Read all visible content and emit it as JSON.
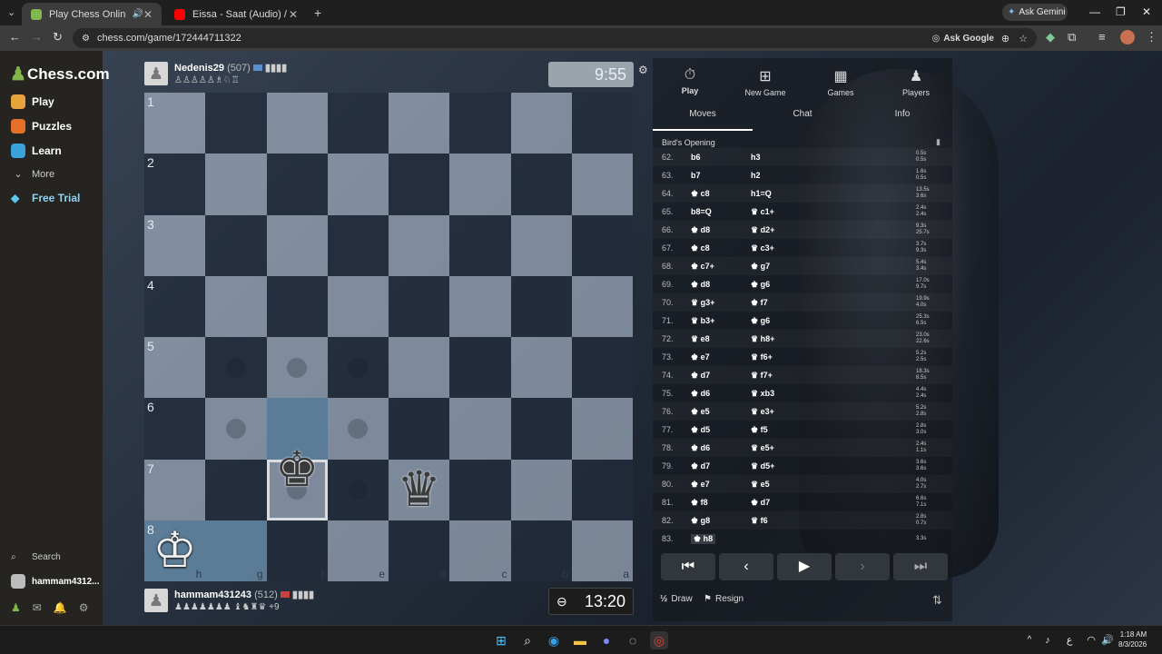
{
  "browser": {
    "tabs": [
      {
        "title": "Play Chess Online for FREE",
        "active": true
      },
      {
        "title": "Eissa - Saat (Audio) / ساعات - ...",
        "active": false
      }
    ],
    "url": "chess.com/game/172444711322",
    "ask_gemini": "Ask Gemini",
    "ask_google": "Ask Google"
  },
  "sidebar": {
    "logo": "Chess.com",
    "items": [
      {
        "label": "Play",
        "color": "#e8a33d"
      },
      {
        "label": "Puzzles",
        "color": "#e5702a"
      },
      {
        "label": "Learn",
        "color": "#3aa2d8"
      },
      {
        "label": "More",
        "color": "#888888"
      },
      {
        "label": "Free Trial",
        "color": "#5ec9e8"
      }
    ],
    "search": "Search",
    "user": "hammam4312..."
  },
  "top_player": {
    "name": "Nedenis29",
    "rating": "(507)",
    "clock": "9:55"
  },
  "bottom_player": {
    "name": "hammam431243",
    "rating": "(512)",
    "extra": "+9",
    "clock": "13:20"
  },
  "board": {
    "ranks": [
      "1",
      "2",
      "3",
      "4",
      "5",
      "6",
      "7",
      "8"
    ],
    "files": [
      "h",
      "g",
      "f",
      "e",
      "d",
      "c",
      "b",
      "a"
    ]
  },
  "panel": {
    "tabs": [
      "Play",
      "New Game",
      "Games",
      "Players"
    ],
    "subtabs": [
      "Moves",
      "Chat",
      "Info"
    ],
    "opening": "Bird's Opening",
    "moves": [
      {
        "n": "62.",
        "w": "b6",
        "b": "h3",
        "t": [
          "0.5s",
          "0.5s"
        ]
      },
      {
        "n": "63.",
        "w": "b7",
        "b": "h2",
        "t": [
          "1.6s",
          "0.5s"
        ]
      },
      {
        "n": "64.",
        "w": "♚ c8",
        "b": "h1=Q",
        "t": [
          "13.5s",
          "3.6s"
        ]
      },
      {
        "n": "65.",
        "w": "b8=Q",
        "b": "♛ c1+",
        "t": [
          "2.4s",
          "2.4s"
        ]
      },
      {
        "n": "66.",
        "w": "♚ d8",
        "b": "♛ d2+",
        "t": [
          "9.3s",
          "25.7s"
        ]
      },
      {
        "n": "67.",
        "w": "♚ c8",
        "b": "♛ c3+",
        "t": [
          "3.7s",
          "9.3s"
        ]
      },
      {
        "n": "68.",
        "w": "♚ c7+",
        "b": "♚ g7",
        "t": [
          "5.4s",
          "3.4s"
        ]
      },
      {
        "n": "69.",
        "w": "♚ d8",
        "b": "♚ g6",
        "t": [
          "17.0s",
          "9.7s"
        ]
      },
      {
        "n": "70.",
        "w": "♛ g3+",
        "b": "♚ f7",
        "t": [
          "19.9s",
          "4.0s"
        ]
      },
      {
        "n": "71.",
        "w": "♛ b3+",
        "b": "♚ g6",
        "t": [
          "25.3s",
          "6.5s"
        ]
      },
      {
        "n": "72.",
        "w": "♛ e8",
        "b": "♛ h8+",
        "t": [
          "23.0s",
          "22.6s"
        ]
      },
      {
        "n": "73.",
        "w": "♚ e7",
        "b": "♛ f6+",
        "t": [
          "5.2s",
          "2.5s"
        ]
      },
      {
        "n": "74.",
        "w": "♚ d7",
        "b": "♛ f7+",
        "t": [
          "18.3s",
          "8.5s"
        ]
      },
      {
        "n": "75.",
        "w": "♚ d6",
        "b": "♛ xb3",
        "t": [
          "4.4s",
          "2.4s"
        ]
      },
      {
        "n": "76.",
        "w": "♚ e5",
        "b": "♛ e3+",
        "t": [
          "5.2s",
          "2.8s"
        ]
      },
      {
        "n": "77.",
        "w": "♚ d5",
        "b": "♚ f5",
        "t": [
          "2.8s",
          "3.0s"
        ]
      },
      {
        "n": "78.",
        "w": "♚ d6",
        "b": "♛ e5+",
        "t": [
          "2.4s",
          "1.1s"
        ]
      },
      {
        "n": "79.",
        "w": "♚ d7",
        "b": "♛ d5+",
        "t": [
          "3.6s",
          "3.6s"
        ]
      },
      {
        "n": "80.",
        "w": "♚ e7",
        "b": "♛ e5",
        "t": [
          "4.0s",
          "2.7s"
        ]
      },
      {
        "n": "81.",
        "w": "♚ f8",
        "b": "♚ d7",
        "t": [
          "6.6s",
          "7.1s"
        ]
      },
      {
        "n": "82.",
        "w": "♚ g8",
        "b": "♛ f6",
        "t": [
          "2.8s",
          "0.7s"
        ]
      },
      {
        "n": "83.",
        "w": "♚ h8",
        "b": "",
        "t": [
          "3.3s",
          ""
        ]
      }
    ],
    "draw": "Draw",
    "resign": "Resign"
  },
  "taskbar": {
    "lang": "ع",
    "time": "1:18 AM",
    "date": "8/3/2026"
  }
}
